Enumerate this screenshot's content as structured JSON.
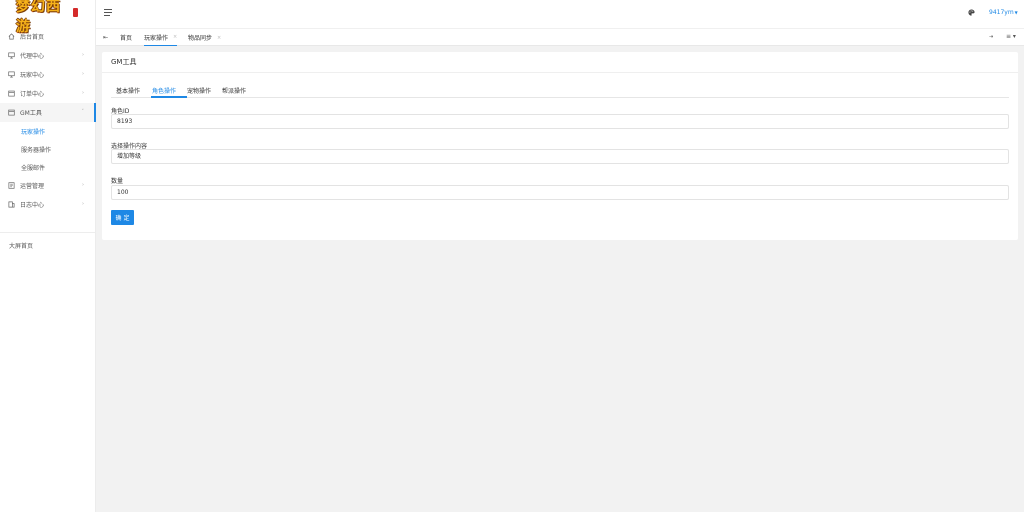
{
  "logo": {
    "text": "梦幻西游"
  },
  "sidebar": {
    "items": [
      {
        "label": "后台首页",
        "icon": "home-icon",
        "chevron": ""
      },
      {
        "label": "代理中心",
        "icon": "monitor-icon",
        "chevron": "›"
      },
      {
        "label": "玩家中心",
        "icon": "monitor-icon",
        "chevron": "›"
      },
      {
        "label": "订单中心",
        "icon": "calendar-icon",
        "chevron": "›"
      },
      {
        "label": "GM工具",
        "icon": "calendar-icon",
        "chevron": "˅"
      }
    ],
    "sub_items": [
      {
        "label": "玩家操作"
      },
      {
        "label": "服务器操作"
      },
      {
        "label": "全服邮件"
      }
    ],
    "items2": [
      {
        "label": "运营管理",
        "icon": "book-icon",
        "chevron": "›"
      },
      {
        "label": "日志中心",
        "icon": "log-icon",
        "chevron": "›"
      }
    ],
    "big_screen": "大屏首页"
  },
  "topbar": {
    "user": "9417ym",
    "user_caret": "▼"
  },
  "tabs": {
    "home_icon": "⇤",
    "close_glyph": "×",
    "right_arrow": "⇥",
    "menu": "≡ ▾",
    "items": [
      {
        "label": "首页"
      },
      {
        "label": "玩家操作"
      },
      {
        "label": "物品同步"
      }
    ]
  },
  "card": {
    "title": "GM工具",
    "subtabs": [
      {
        "label": "基本操作"
      },
      {
        "label": "角色操作"
      },
      {
        "label": "宠物操作"
      },
      {
        "label": "帮派操作"
      }
    ],
    "fields": [
      {
        "label": "角色ID",
        "value": "8193"
      },
      {
        "label": "选择操作内容",
        "value": "增加等级"
      },
      {
        "label": "数量",
        "value": "100"
      }
    ],
    "confirm": "确 定"
  },
  "colors": {
    "accent": "#1e88e5",
    "background": "#f2f2f2"
  }
}
